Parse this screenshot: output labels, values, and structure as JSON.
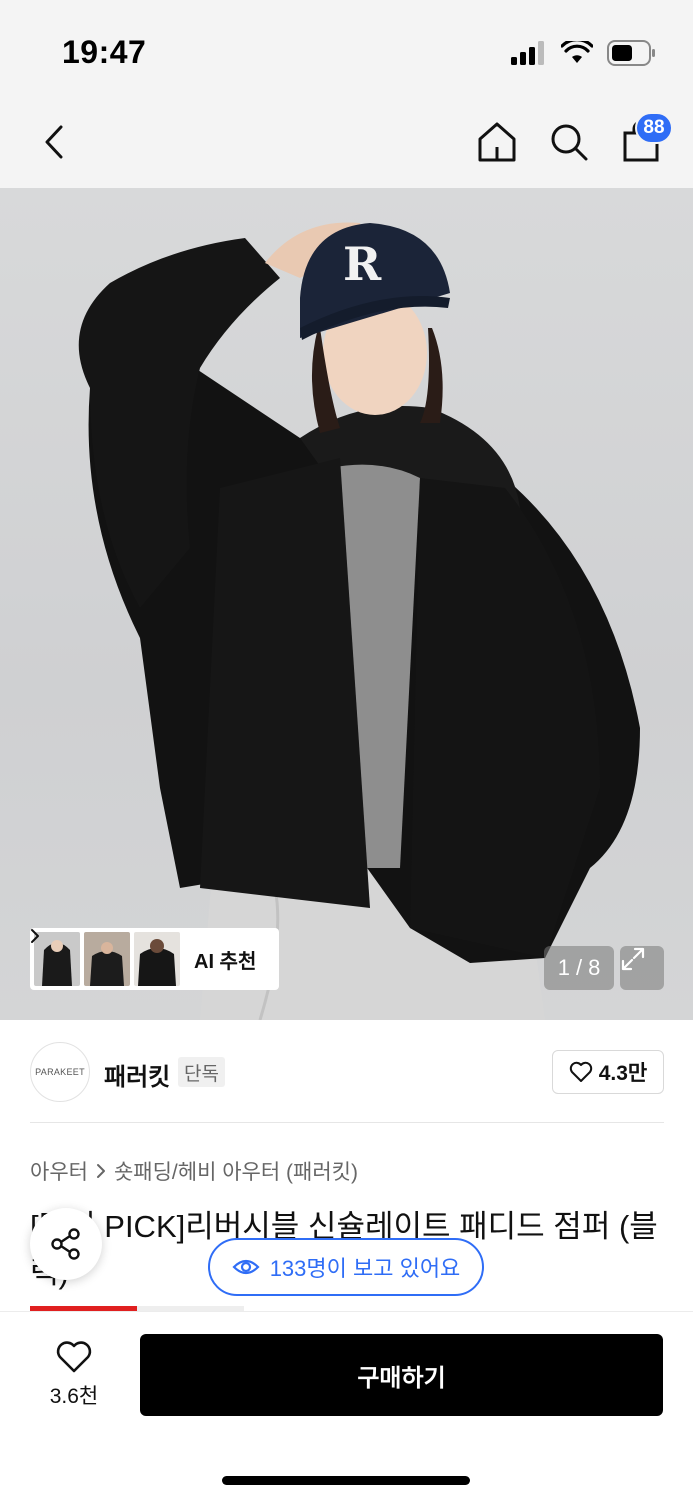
{
  "status_bar": {
    "time": "19:47"
  },
  "nav": {
    "cart_count": "88"
  },
  "gallery": {
    "ai_label": "AI 추천",
    "page_current": "1",
    "page_sep": "/",
    "page_total": "8"
  },
  "brand": {
    "logo_text": "PARAKEET",
    "name": "패러킷",
    "tag": "단독",
    "likes": "4.3만"
  },
  "breadcrumb": {
    "category": "아우터",
    "subcategory": "숏패딩/헤비 아우터 (패러킷)"
  },
  "product": {
    "title": "[멤버 PICK]리버시블 신슐레이트 패디드 점퍼 (블랙)"
  },
  "viewers": {
    "text": "133명이 보고 있어요"
  },
  "bottom": {
    "wish_count": "3.6천",
    "buy_label": "구매하기"
  },
  "colors": {
    "accent": "#2f6df6",
    "buy": "#000000",
    "progress": "#e02020"
  },
  "progress_fraction": 0.5
}
